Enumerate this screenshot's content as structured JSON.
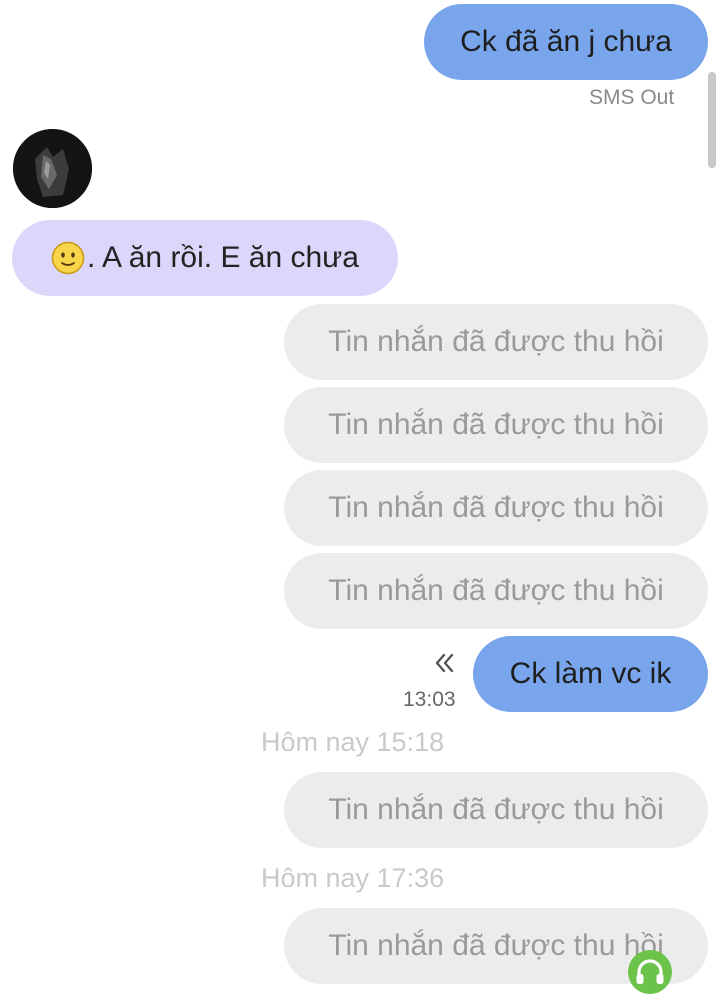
{
  "messages": {
    "out_1": "Ck đã ăn j chưa",
    "out_1_status": "SMS Out",
    "in_1": ". A ăn rồi. E ăn chưa",
    "recalled_text": "Tin nhắn đã được thu hồi",
    "out_2": "Ck làm vc ik",
    "out_2_time": "13:03",
    "divider_1": "Hôm nay 15:18",
    "divider_2": "Hôm nay 17:36"
  },
  "icons": {
    "resend": "double-chevron-left-icon",
    "emoji": "slight-smile-emoji",
    "floating": "headphones-icon"
  },
  "colors": {
    "outgoing_bubble": "#78a5ec",
    "incoming_bubble": "#dcd7fa",
    "recalled_bubble": "#ececec",
    "floating_button": "#6cc34a"
  }
}
